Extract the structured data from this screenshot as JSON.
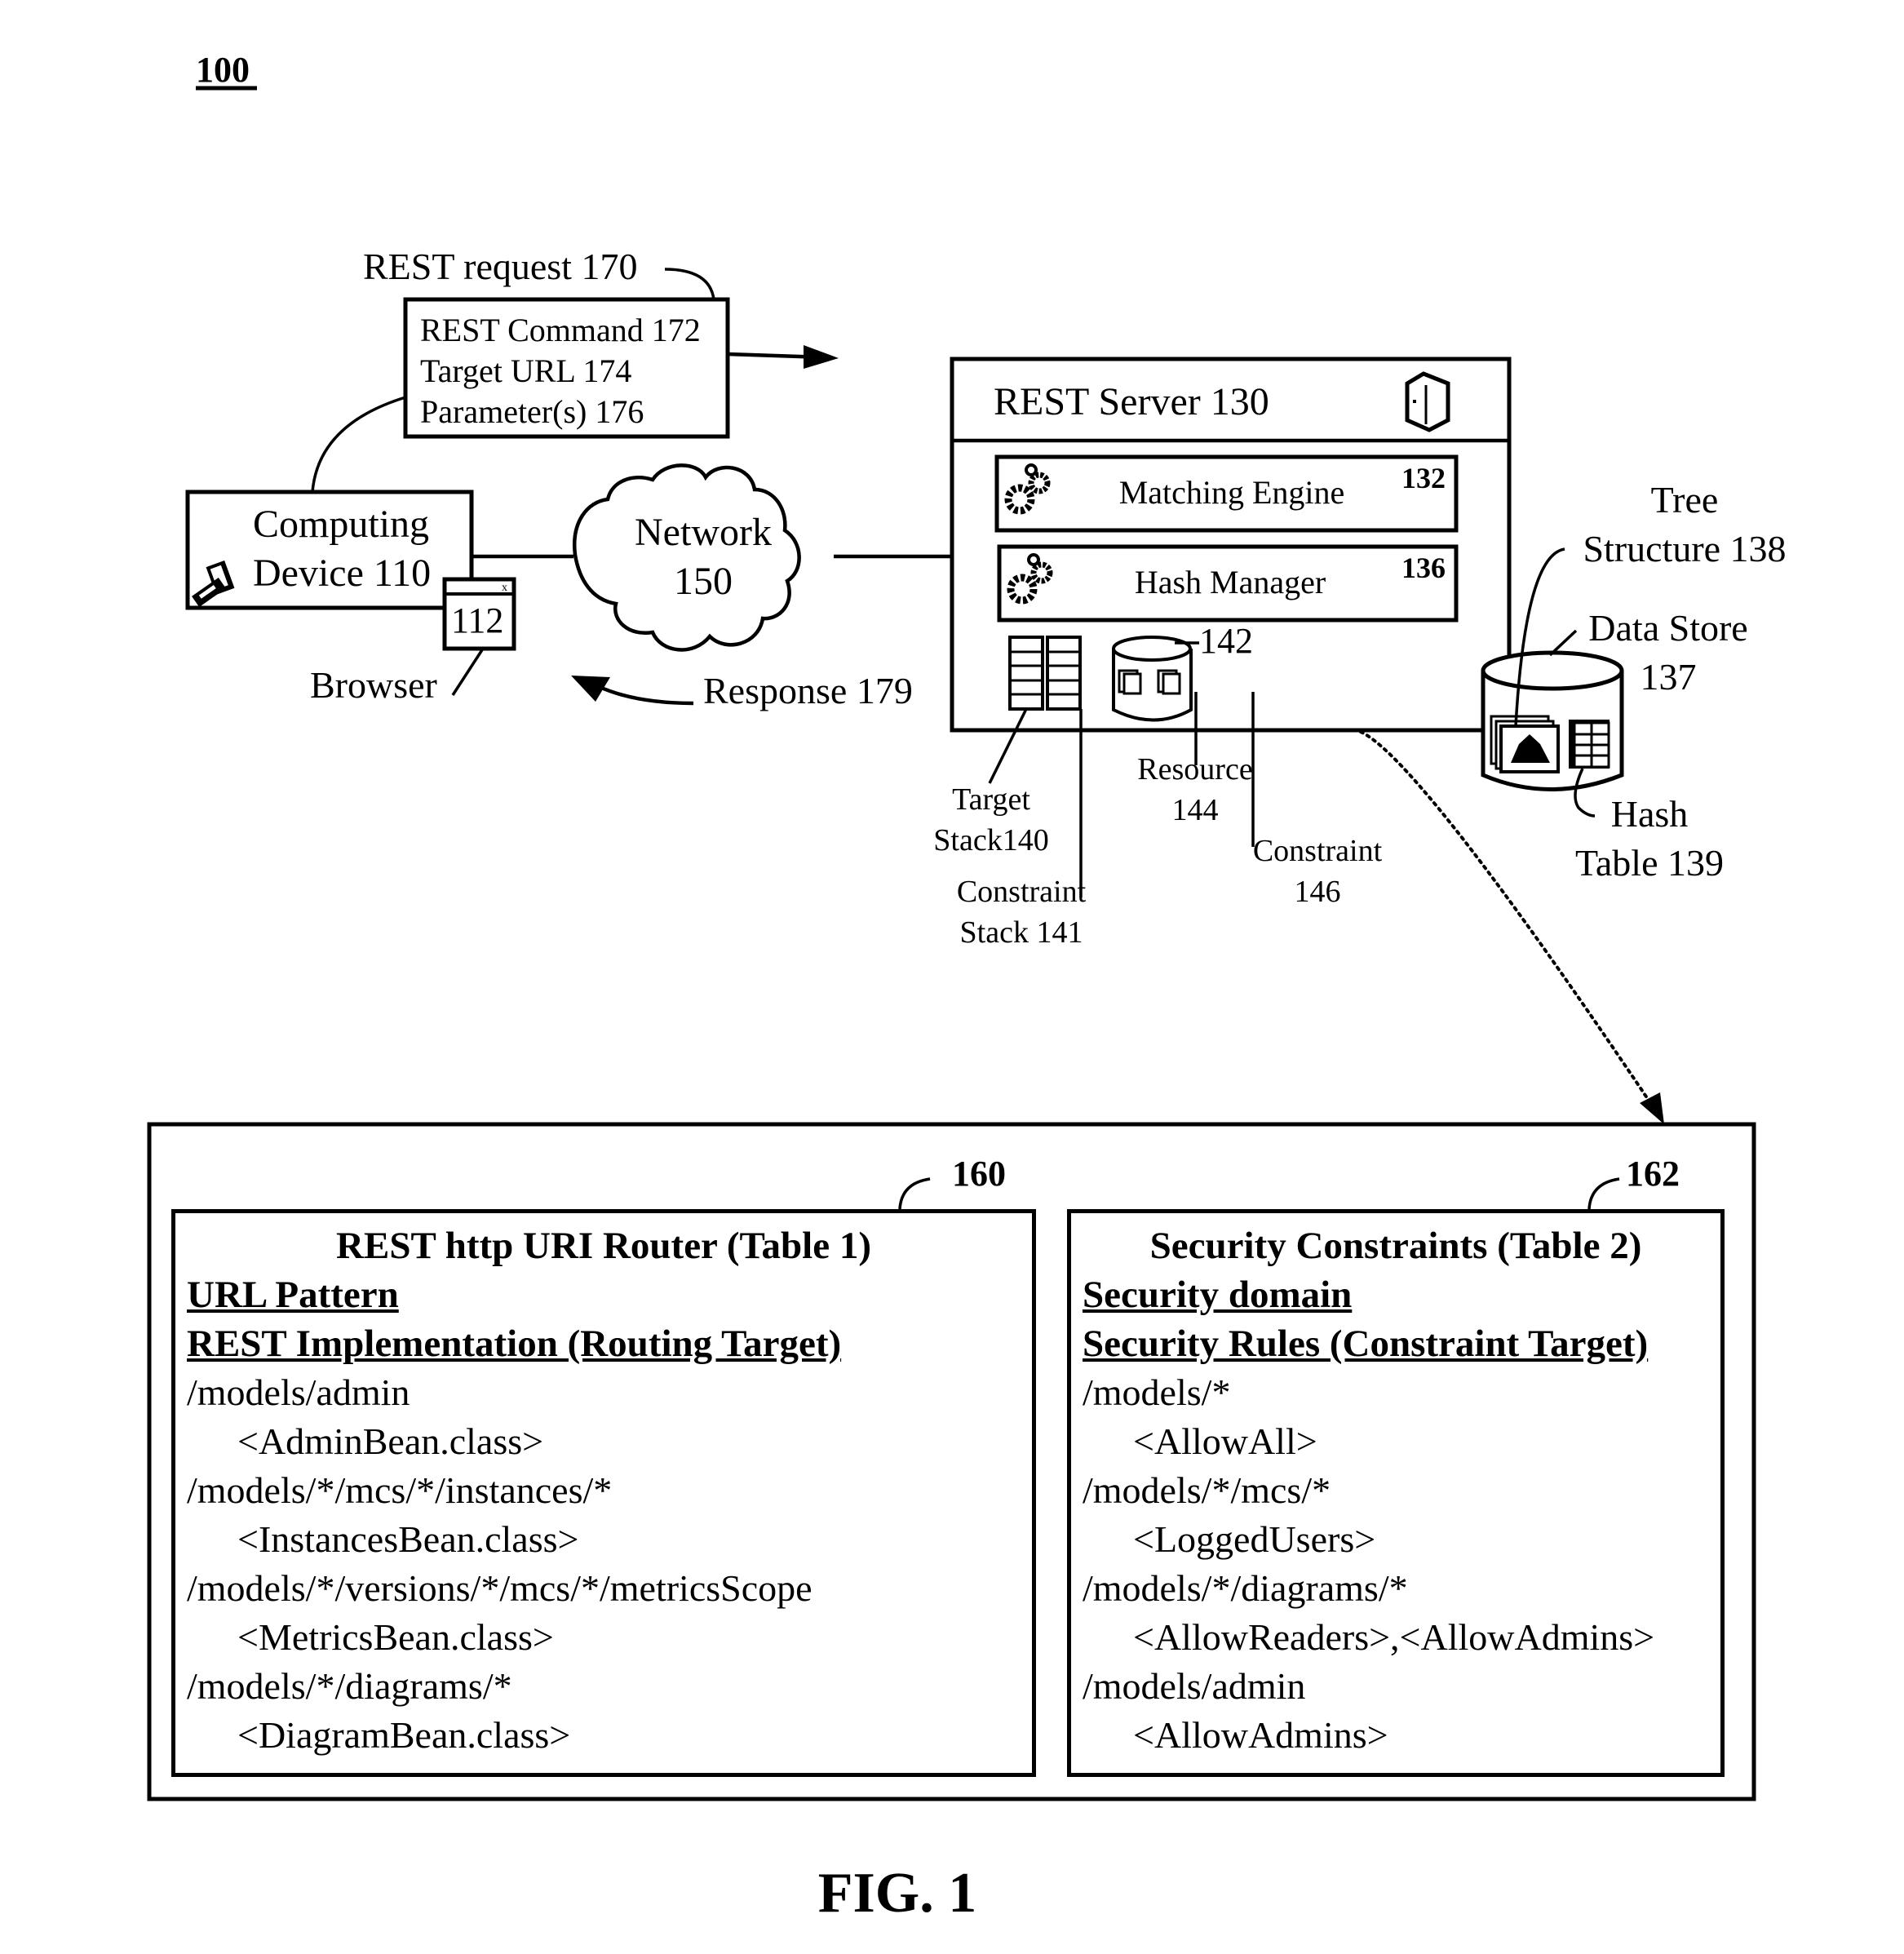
{
  "figure": {
    "ref_number": "100",
    "caption": "FIG. 1"
  },
  "rest_request": {
    "label": "REST request 170",
    "fields": [
      "REST Command 172",
      "Target URL 174",
      "Parameter(s) 176"
    ]
  },
  "computing_device": {
    "line1": "Computing",
    "line2": "Device 110",
    "icon": "computer-icon"
  },
  "browser": {
    "window_number": "112",
    "close_glyph": "x",
    "label": "Browser"
  },
  "network": {
    "line1": "Network",
    "line2": "150"
  },
  "response": {
    "label": "Response 179"
  },
  "rest_server": {
    "title": "REST Server 130",
    "icon": "server-icon",
    "modules": [
      {
        "label": "Matching Engine",
        "number": "132",
        "icon": "gears-icon"
      },
      {
        "label": "Hash Manager",
        "number": "136",
        "icon": "gears-icon"
      }
    ],
    "resource_store_number": "142",
    "target_stack": {
      "line1": "Target",
      "line2": "Stack140"
    },
    "constraint_stack": {
      "line1": "Constraint",
      "line2": "Stack 141"
    },
    "resource": {
      "line1": "Resource",
      "line2": "144"
    },
    "constraint": {
      "line1": "Constraint",
      "line2": "146"
    }
  },
  "data_store": {
    "line1": "Data Store",
    "line2": "137",
    "tree_structure": {
      "line1": "Tree",
      "line2": "Structure 138"
    },
    "hash_table": {
      "line1": "Hash",
      "line2": "Table 139"
    }
  },
  "tables": [
    {
      "number": "160",
      "title": "REST http URI Router  (Table 1)",
      "column_headers": [
        "URL Pattern",
        "REST Implementation (Routing Target)"
      ],
      "rows": [
        {
          "pattern": "/models/admin",
          "target": "<AdminBean.class>"
        },
        {
          "pattern": "/models/*/mcs/*/instances/*",
          "target": "<InstancesBean.class>"
        },
        {
          "pattern": "/models/*/versions/*/mcs/*/metricsScope",
          "target": "<MetricsBean.class>"
        },
        {
          "pattern": "/models/*/diagrams/*",
          "target": "<DiagramBean.class>"
        }
      ]
    },
    {
      "number": "162",
      "title": "Security Constraints (Table 2)",
      "column_headers": [
        "Security domain",
        "Security Rules (Constraint Target)"
      ],
      "rows": [
        {
          "pattern": "/models/*",
          "target": "<AllowAll>"
        },
        {
          "pattern": "/models/*/mcs/*",
          "target": "<LoggedUsers>"
        },
        {
          "pattern": "/models/*/diagrams/*",
          "target": "<AllowReaders>,<AllowAdmins>"
        },
        {
          "pattern": "/models/admin",
          "target": "<AllowAdmins>"
        }
      ]
    }
  ]
}
